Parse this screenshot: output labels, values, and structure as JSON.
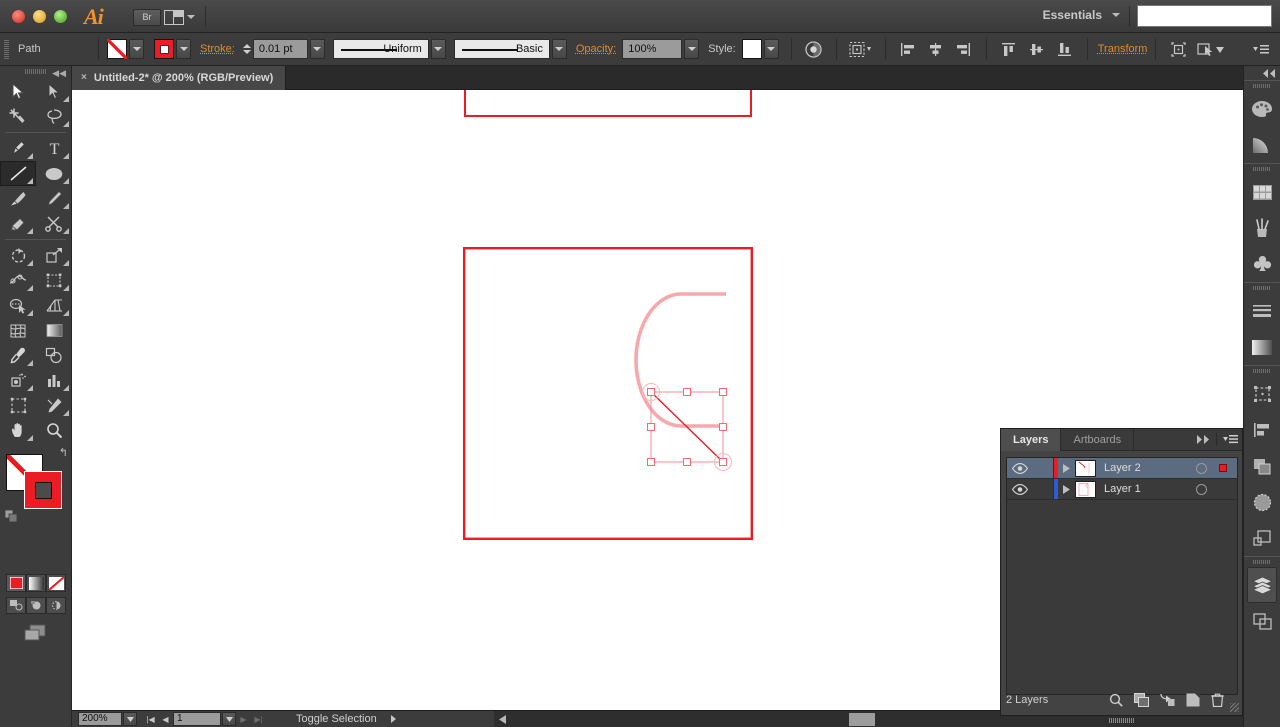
{
  "app": {
    "name": "Ai",
    "bridge_label": "Br",
    "workspace": "Essentials",
    "search_value": ""
  },
  "control_bar": {
    "selection_type": "Path",
    "fill_label": "fill-none",
    "stroke_swatch_label": "stroke-red",
    "stroke_label": "Stroke:",
    "stroke_weight": "0.01 pt",
    "profile": "Uniform",
    "brush": "Basic",
    "opacity_label": "Opacity:",
    "opacity_value": "100%",
    "style_label": "Style:",
    "transform_label": "Transform",
    "align_icons": [
      "align-left",
      "align-center-h",
      "align-right",
      "align-top",
      "align-center-v",
      "align-bottom"
    ],
    "recolor_icon": "recolor-artwork-icon",
    "isolate_icon": "isolate-selected-icon",
    "shape_icon": "shape-options-icon",
    "select_similar_icon": "select-similar-icon",
    "panel_menu_icon": "panel-menu-icon"
  },
  "document": {
    "tab_title": "Untitled-2* @ 200% (RGB/Preview)",
    "close_glyph": "×"
  },
  "tools": {
    "items": [
      {
        "name": "selection-tool",
        "selected": false
      },
      {
        "name": "direct-selection-tool",
        "selected": false
      },
      {
        "name": "magic-wand-tool",
        "selected": false
      },
      {
        "name": "lasso-tool",
        "selected": false
      },
      {
        "name": "pen-tool",
        "selected": false
      },
      {
        "name": "type-tool",
        "selected": false
      },
      {
        "name": "line-segment-tool",
        "selected": true
      },
      {
        "name": "ellipse-tool",
        "selected": false
      },
      {
        "name": "paintbrush-tool",
        "selected": false
      },
      {
        "name": "pencil-tool",
        "selected": false
      },
      {
        "name": "blob-brush-tool",
        "selected": false
      },
      {
        "name": "eraser-scissors-tool",
        "selected": false
      },
      {
        "name": "rotate-tool",
        "selected": false
      },
      {
        "name": "scale-tool",
        "selected": false
      },
      {
        "name": "width-tool",
        "selected": false
      },
      {
        "name": "free-transform-tool",
        "selected": false
      },
      {
        "name": "shape-builder-tool",
        "selected": false
      },
      {
        "name": "perspective-grid-tool",
        "selected": false
      },
      {
        "name": "mesh-tool",
        "selected": false
      },
      {
        "name": "gradient-tool",
        "selected": false
      },
      {
        "name": "eyedropper-tool",
        "selected": false
      },
      {
        "name": "blend-tool",
        "selected": false
      },
      {
        "name": "symbol-sprayer-tool",
        "selected": false
      },
      {
        "name": "column-graph-tool",
        "selected": false
      },
      {
        "name": "artboard-tool",
        "selected": false
      },
      {
        "name": "slice-tool",
        "selected": false
      },
      {
        "name": "hand-tool",
        "selected": false
      },
      {
        "name": "zoom-tool",
        "selected": false
      }
    ],
    "fill": {
      "name": "fill-swatch",
      "value": "none"
    },
    "stroke": {
      "name": "stroke-swatch",
      "value": "#ec1c24"
    },
    "color_modes": [
      "color-mode",
      "gradient-mode",
      "none-mode"
    ],
    "draw_modes": [
      "draw-normal",
      "draw-behind",
      "draw-inside"
    ],
    "screen_mode": "change-screen-mode"
  },
  "canvas": {
    "artboard_top": {
      "name": "artboard-upper",
      "stroke": "#ec1c24"
    },
    "artboard_bottom": {
      "name": "artboard-lower",
      "stroke": "#ec1c24"
    },
    "ghost_shape": {
      "name": "rounded-capsule-shape",
      "stroke": "#f7a8ad"
    },
    "selected_line": {
      "name": "selected-line-segment",
      "stroke": "#ec1c24"
    }
  },
  "status_bar": {
    "zoom": "200%",
    "page": "1",
    "message": "Toggle Selection"
  },
  "right_dock": {
    "collapse_icon": "collapse-panels-icon",
    "groups": [
      [
        "color-panel-icon",
        "color-guide-panel-icon"
      ],
      [
        "swatches-panel-icon",
        "brushes-panel-icon",
        "symbols-panel-icon"
      ],
      [
        "stroke-panel-icon",
        "gradient-panel-icon"
      ],
      [
        "transform-panel-icon",
        "align-panel-icon",
        "pathfinder-panel-icon"
      ],
      [
        "transparency-panel-icon",
        "appearance-panel-icon",
        "graphic-styles-panel-icon"
      ],
      [
        "layers-panel-icon",
        "artboards-panel-icon"
      ]
    ]
  },
  "layers_panel": {
    "tabs": [
      {
        "label": "Layers",
        "active": true
      },
      {
        "label": "Artboards",
        "active": false
      }
    ],
    "rows": [
      {
        "name": "Layer 2",
        "color": "#ec1c24",
        "visible": true,
        "selected": true,
        "targeted": true
      },
      {
        "name": "Layer 1",
        "color": "#2a5fd4",
        "visible": true,
        "selected": false,
        "targeted": false
      }
    ],
    "footer_count": "2 Layers",
    "footer_icons": [
      "locate-object-icon",
      "make-clipping-mask-icon",
      "create-sublayer-icon",
      "create-new-layer-icon",
      "delete-selection-icon"
    ]
  }
}
